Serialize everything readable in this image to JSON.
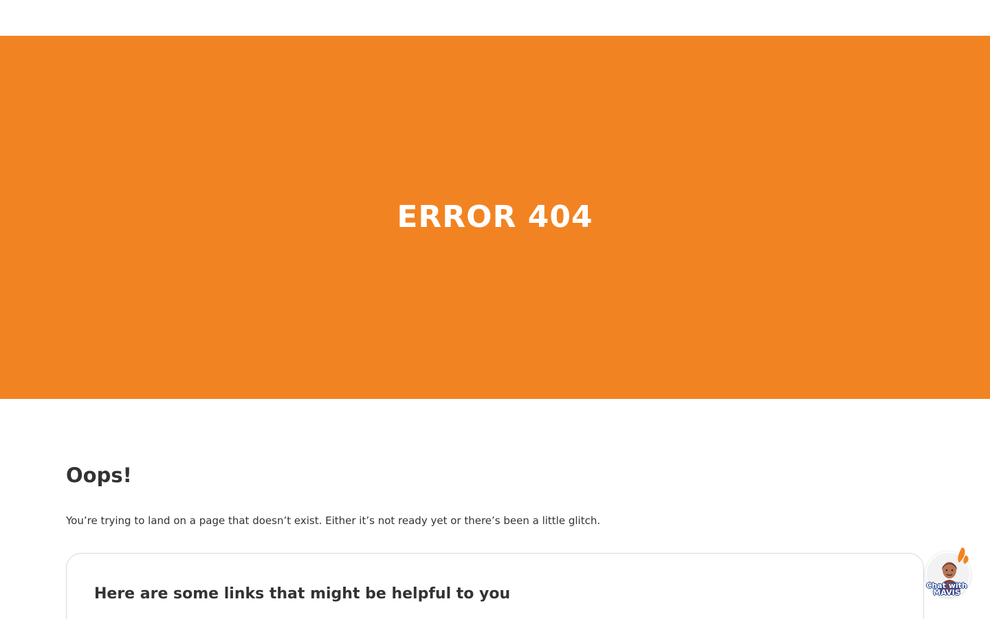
{
  "hero": {
    "title": "ERROR 404"
  },
  "content": {
    "title": "Oops!",
    "message": "You’re trying to land on a page that doesn’t exist. Either it’s not ready yet or there’s been a little glitch."
  },
  "links": {
    "title": "Here are some links that might be helpful to you"
  },
  "chat": {
    "label": "Chat with\nMAVIS",
    "icon": "person-avatar-icon"
  },
  "colors": {
    "hero_background": "#f28322",
    "hero_text": "#ffffff",
    "body_text": "#333333",
    "chat_label_outline": "#1a3f91"
  }
}
